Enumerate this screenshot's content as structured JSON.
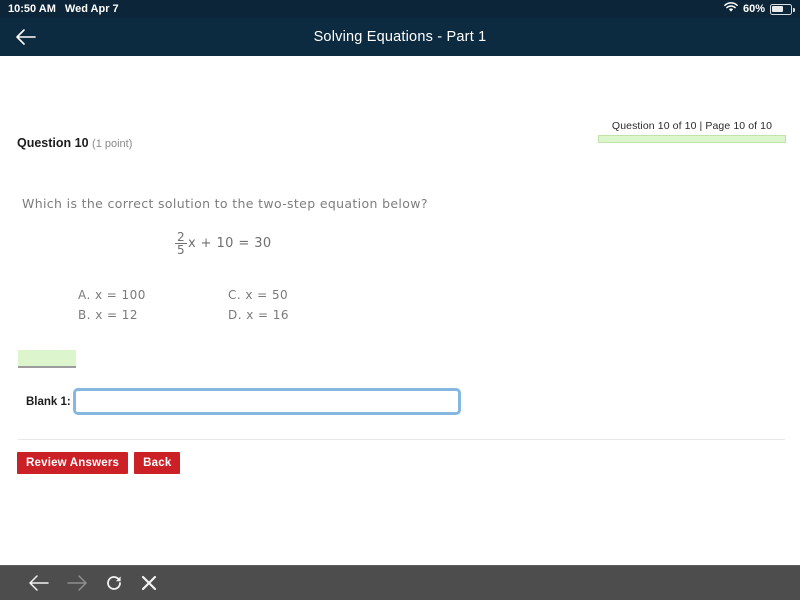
{
  "status_bar": {
    "time": "10:50 AM",
    "date": "Wed Apr 7",
    "battery_percent": "60%",
    "wifi_icon": "wifi-icon",
    "battery_icon": "battery-icon"
  },
  "nav_bar": {
    "back_icon": "arrow-left-icon",
    "title": "Solving Equations - Part 1"
  },
  "progress": {
    "label": "Question 10 of 10 | Page 10 of 10",
    "fill_percent": 100,
    "bar_color": "#ddf5cc",
    "bar_border_color": "#bfe3a8"
  },
  "question": {
    "number_label": "Question 10",
    "points_label": "(1 point)",
    "prompt": "Which is the correct solution to the two-step equation below?",
    "equation": {
      "numerator": "2",
      "denominator": "5",
      "rest": "x + 10 = 30"
    },
    "choices_left": [
      "A. x = 100",
      "B. x = 12"
    ],
    "choices_right": [
      "C. x = 50",
      "D. x = 16"
    ]
  },
  "answer_area": {
    "blank_label": "Blank 1:",
    "blank_value": "",
    "blank_placeholder": "",
    "highlight_color": "#ddf5cc"
  },
  "buttons": {
    "review_answers": "Review Answers",
    "back": "Back",
    "color": "#cc2027"
  },
  "bottom_toolbar": {
    "back_icon": "arrow-left-icon",
    "forward_icon": "arrow-right-icon",
    "reload_icon": "reload-icon",
    "close_icon": "close-x-icon"
  }
}
